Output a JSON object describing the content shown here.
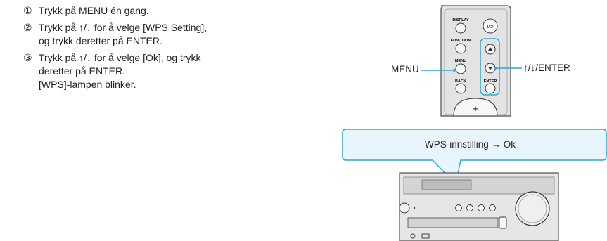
{
  "steps": [
    {
      "num": "①",
      "line1": "Trykk på MENU én gang.",
      "line2": ""
    },
    {
      "num": "②",
      "line1": "Trykk på ↑/↓ for å velge [WPS Setting],",
      "line2": "og trykk deretter på ENTER."
    },
    {
      "num": "③",
      "line1": "Trykk på ↑/↓ for å velge [Ok], og trykk",
      "line2": "deretter på ENTER."
    }
  ],
  "note": "[WPS]-lampen blinker.",
  "remote": {
    "display_label": "DISPLAY",
    "power_label": "I/⏻",
    "function_label": "FUNCTION",
    "menu_label": "MENU",
    "back_label": "BACK",
    "enter_label": "ENTER",
    "plus_label": "+"
  },
  "callouts": {
    "menu": "MENU",
    "enter": "↑/↓/ENTER"
  },
  "display_bubble": "WPS-innstilling → Ok",
  "colors": {
    "accent": "#29a9e0",
    "bubble_fill": "#e8f5fc",
    "device_gray": "#d9d9d9"
  }
}
